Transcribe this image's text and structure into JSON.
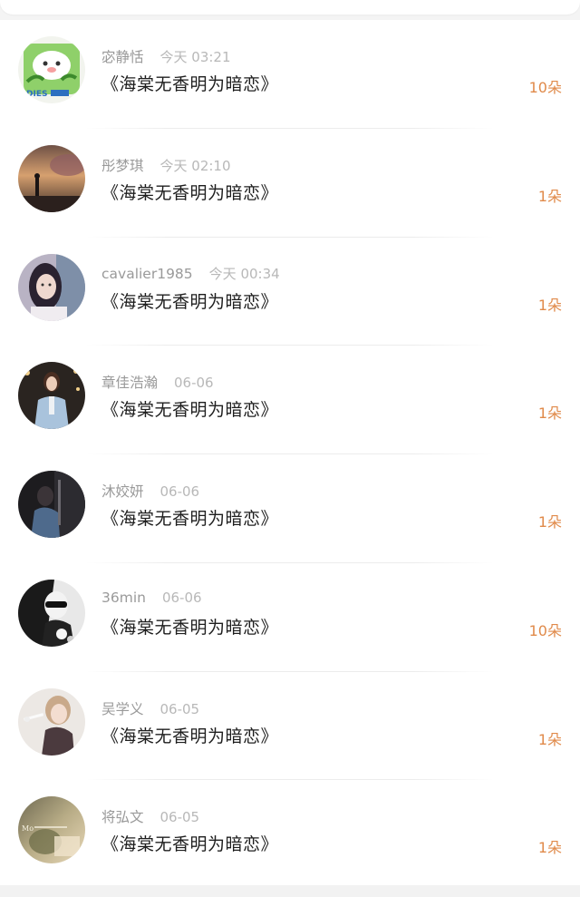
{
  "rows": [
    {
      "user": "宓静恬",
      "time": "今天 03:21",
      "song": "《海棠无香明为暗恋》",
      "count": "10朵",
      "avatar": "green-cartoon-avatar"
    },
    {
      "user": "彤梦琪",
      "time": "今天 02:10",
      "song": "《海棠无香明为暗恋》",
      "count": "1朵",
      "avatar": "sunset-silhouette-avatar"
    },
    {
      "user": "cavalier1985",
      "time": "今天 00:34",
      "song": "《海棠无香明为暗恋》",
      "count": "1朵",
      "avatar": "portrait-girl-avatar"
    },
    {
      "user": "章佳浩瀚",
      "time": "06-06",
      "song": "《海棠无香明为暗恋》",
      "count": "1朵",
      "avatar": "woman-blazer-avatar"
    },
    {
      "user": "沐姣妍",
      "time": "06-06",
      "song": "《海棠无香明为暗恋》",
      "count": "1朵",
      "avatar": "dark-portrait-avatar"
    },
    {
      "user": "36min",
      "time": "06-06",
      "song": "《海棠无香明为暗恋》",
      "count": "10朵",
      "avatar": "bw-sunglasses-avatar"
    },
    {
      "user": "吴学义",
      "time": "06-05",
      "song": "《海棠无香明为暗恋》",
      "count": "1朵",
      "avatar": "light-portrait-avatar"
    },
    {
      "user": "将弘文",
      "time": "06-05",
      "song": "《海棠无香明为暗恋》",
      "count": "1朵",
      "avatar": "vintage-text-avatar"
    }
  ],
  "avatar_text": {
    "row0": "DIES",
    "row7": "Mo"
  },
  "colors": {
    "count": "#e08a4a",
    "username": "#9a9a9a",
    "song": "#1e1e1e"
  }
}
